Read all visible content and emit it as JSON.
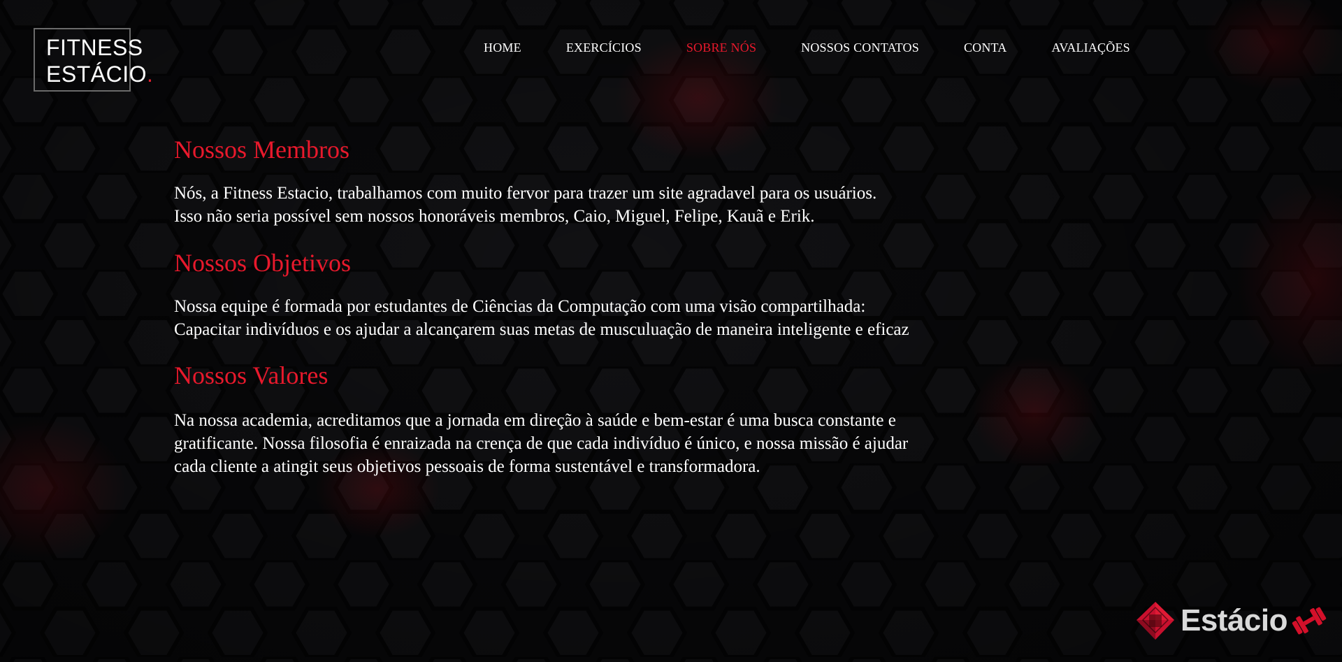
{
  "logo": {
    "line1": "FITNESS",
    "line2": "ESTÁCIO",
    "dot": "."
  },
  "nav": {
    "items": [
      {
        "label": "HOME",
        "active": false
      },
      {
        "label": "EXERCÍCIOS",
        "active": false
      },
      {
        "label": "SOBRE NÓS",
        "active": true
      },
      {
        "label": "NOSSOS CONTATOS",
        "active": false
      },
      {
        "label": "CONTA",
        "active": false
      },
      {
        "label": "AVALIAÇÕES",
        "active": false
      }
    ]
  },
  "sections": {
    "members": {
      "title": "Nossos Membros",
      "line1": "Nós, a Fitness Estacio, trabalhamos com muito fervor para trazer um site agradavel para os usuários.",
      "line2": "Isso não seria possível sem nossos honoráveis membros, Caio, Miguel, Felipe, Kauã e Erik."
    },
    "goals": {
      "title": "Nossos Objetivos",
      "line1": "Nossa equipe é formada por estudantes de Ciências da Computação com uma visão compartilhada:",
      "line2": "Capacitar indivíduos e os ajudar a alcançarem suas metas de musculuação de maneira inteligente e eficaz"
    },
    "values": {
      "title": "Nossos Valores",
      "line1": "Na nossa academia, acreditamos que a jornada em direção à saúde e bem-estar é uma busca constante e",
      "line2": "gratificante. Nossa filosofia é enraizada na crença de que cada indivíduo é único, e nossa missão é ajudar",
      "line3": "cada cliente a atingit seus objetivos pessoais de forma sustentável e transformadora."
    }
  },
  "brand": {
    "name": "Estácio",
    "icon_left": "cube-icon",
    "icon_right": "dumbbell-icon"
  },
  "colors": {
    "accent": "#e8192c",
    "background": "#0c0c0e",
    "text": "#ffffff",
    "hex_glow": "#8a0d14"
  }
}
